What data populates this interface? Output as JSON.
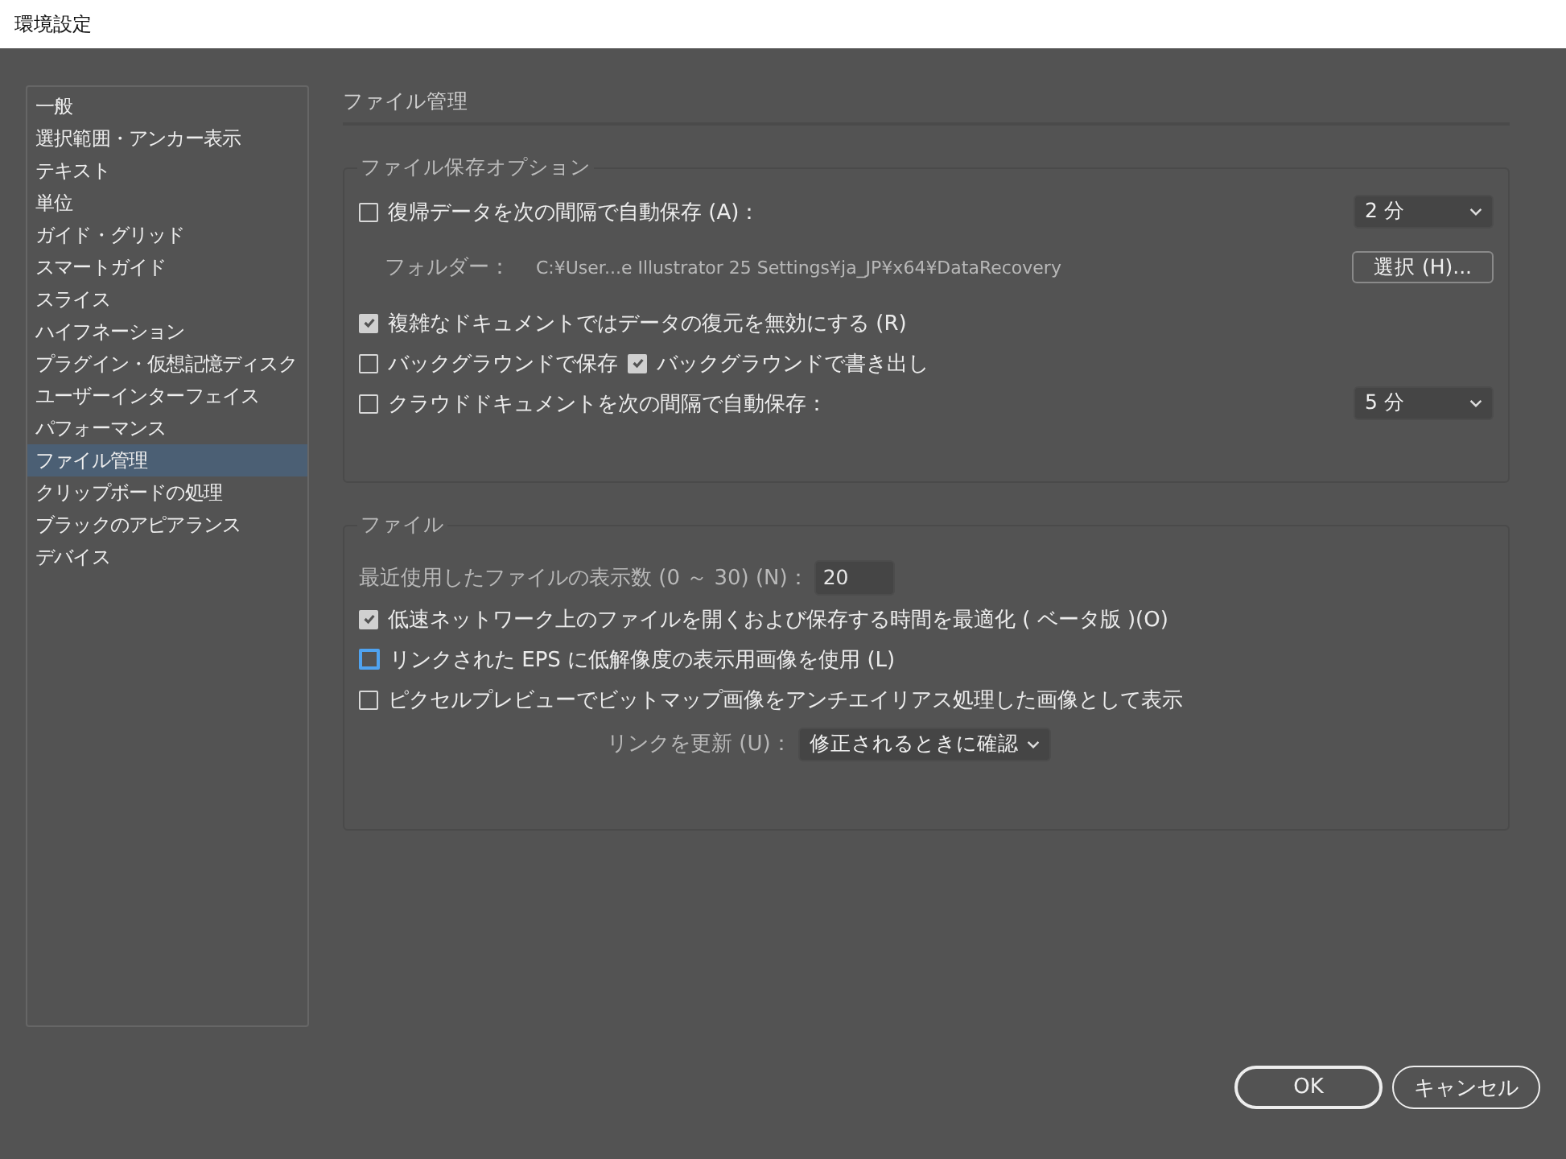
{
  "window": {
    "title": "環境設定"
  },
  "sidebar": {
    "items": [
      {
        "label": "一般",
        "selected": false
      },
      {
        "label": "選択範囲・アンカー表示",
        "selected": false
      },
      {
        "label": "テキスト",
        "selected": false
      },
      {
        "label": "単位",
        "selected": false
      },
      {
        "label": "ガイド・グリッド",
        "selected": false
      },
      {
        "label": "スマートガイド",
        "selected": false
      },
      {
        "label": "スライス",
        "selected": false
      },
      {
        "label": "ハイフネーション",
        "selected": false
      },
      {
        "label": "プラグイン・仮想記憶ディスク",
        "selected": false
      },
      {
        "label": "ユーザーインターフェイス",
        "selected": false
      },
      {
        "label": "パフォーマンス",
        "selected": false
      },
      {
        "label": "ファイル管理",
        "selected": true
      },
      {
        "label": "クリップボードの処理",
        "selected": false
      },
      {
        "label": "ブラックのアピアランス",
        "selected": false
      },
      {
        "label": "デバイス",
        "selected": false
      }
    ]
  },
  "page_title": "ファイル管理",
  "save_options": {
    "legend": "ファイル保存オプション",
    "autosave": {
      "label": "復帰データを次の間隔で自動保存 (A)：",
      "checked": false,
      "interval": "2 分"
    },
    "folder": {
      "label": "フォルダー：",
      "path": "C:¥User...e Illustrator 25 Settings¥ja_JP¥x64¥DataRecovery",
      "button": "選択 (H)..."
    },
    "disable_recovery": {
      "label": "複雑なドキュメントではデータの復元を無効にする (R)",
      "checked": true
    },
    "background": [
      {
        "label": "バックグラウンドで保存",
        "checked": false
      },
      {
        "label": "バックグラウンドで書き出し",
        "checked": true
      }
    ],
    "cloud_autosave": {
      "label": "クラウドドキュメントを次の間隔で自動保存：",
      "checked": false,
      "interval": "5 分"
    }
  },
  "files": {
    "legend": "ファイル",
    "recent": {
      "label": "最近使用したファイルの表示数 (0 ～ 30) (N)：",
      "value": "20"
    },
    "options": [
      {
        "label": "低速ネットワーク上のファイルを開くおよび保存する時間を最適化 ( ベータ版 )(O)",
        "checked": true,
        "focused": false
      },
      {
        "label": "リンクされた EPS に低解像度の表示用画像を使用 (L)",
        "checked": false,
        "focused": true
      },
      {
        "label": "ピクセルプレビューでビットマップ画像をアンチエイリアス処理した画像として表示",
        "checked": false,
        "focused": false
      }
    ],
    "update_links": {
      "label": "リンクを更新 (U)：",
      "value": "修正されるときに確認"
    }
  },
  "buttons": [
    {
      "label": "OK",
      "kind": "default"
    },
    {
      "label": "キャンセル",
      "kind": "normal"
    }
  ]
}
